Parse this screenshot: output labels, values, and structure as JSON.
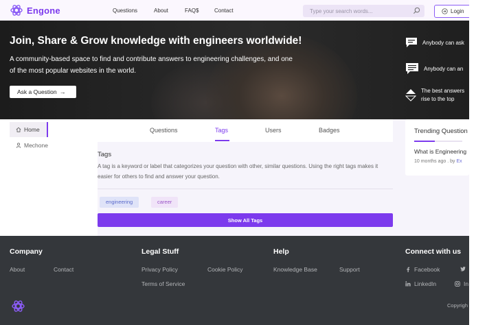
{
  "header": {
    "logo_text": "Engone",
    "nav": [
      "Questions",
      "About",
      "FAQ$",
      "Contact"
    ],
    "search_placeholder": "Type your search words...",
    "login_label": "Login"
  },
  "hero": {
    "title": "Join, Share & Grow knowledge with engineers worldwide!",
    "subtitle": "A community-based space to find and contribute answers to engineering challenges, and one of the most popular websites in the world.",
    "ask_button": "Ask a Question",
    "features": [
      "Anybody can ask",
      "Anybody can an",
      "The best answers",
      "rise to the top"
    ]
  },
  "sidebar": {
    "items": [
      "Home",
      "Mechone"
    ]
  },
  "main": {
    "tabs": [
      "Questions",
      "Tags",
      "Users",
      "Badges"
    ],
    "active_tab": "Tags",
    "section_title": "Tags",
    "description": "A tag is a keyword or label that categorizes your question with other, similar questions. Using the right tags makes it easier for others to find and answer your question.",
    "tags": [
      "engineering",
      "career"
    ],
    "show_all_label": "Show All Tags"
  },
  "trending": {
    "title": "Trending Question",
    "question": "What is Engineering",
    "time": "10 months ago",
    "by_sep": ". by",
    "by_link": "Ex"
  },
  "footer": {
    "company": {
      "heading": "Company",
      "links": [
        "About",
        "Contact"
      ]
    },
    "legal": {
      "heading": "Legal Stuff",
      "links": [
        "Privacy Policy",
        "Cookie Policy",
        "Terms of Service"
      ]
    },
    "help": {
      "heading": "Help",
      "links": [
        "Knowledge Base",
        "Support"
      ]
    },
    "connect": {
      "heading": "Connect with us",
      "links": [
        "Facebook",
        "LinkedIn",
        "In"
      ]
    },
    "copyright": "Copyrigh"
  },
  "colors": {
    "accent": "#7c3aed",
    "footer_bg": "#34373b",
    "hero_bg": "#1f1f1f"
  }
}
